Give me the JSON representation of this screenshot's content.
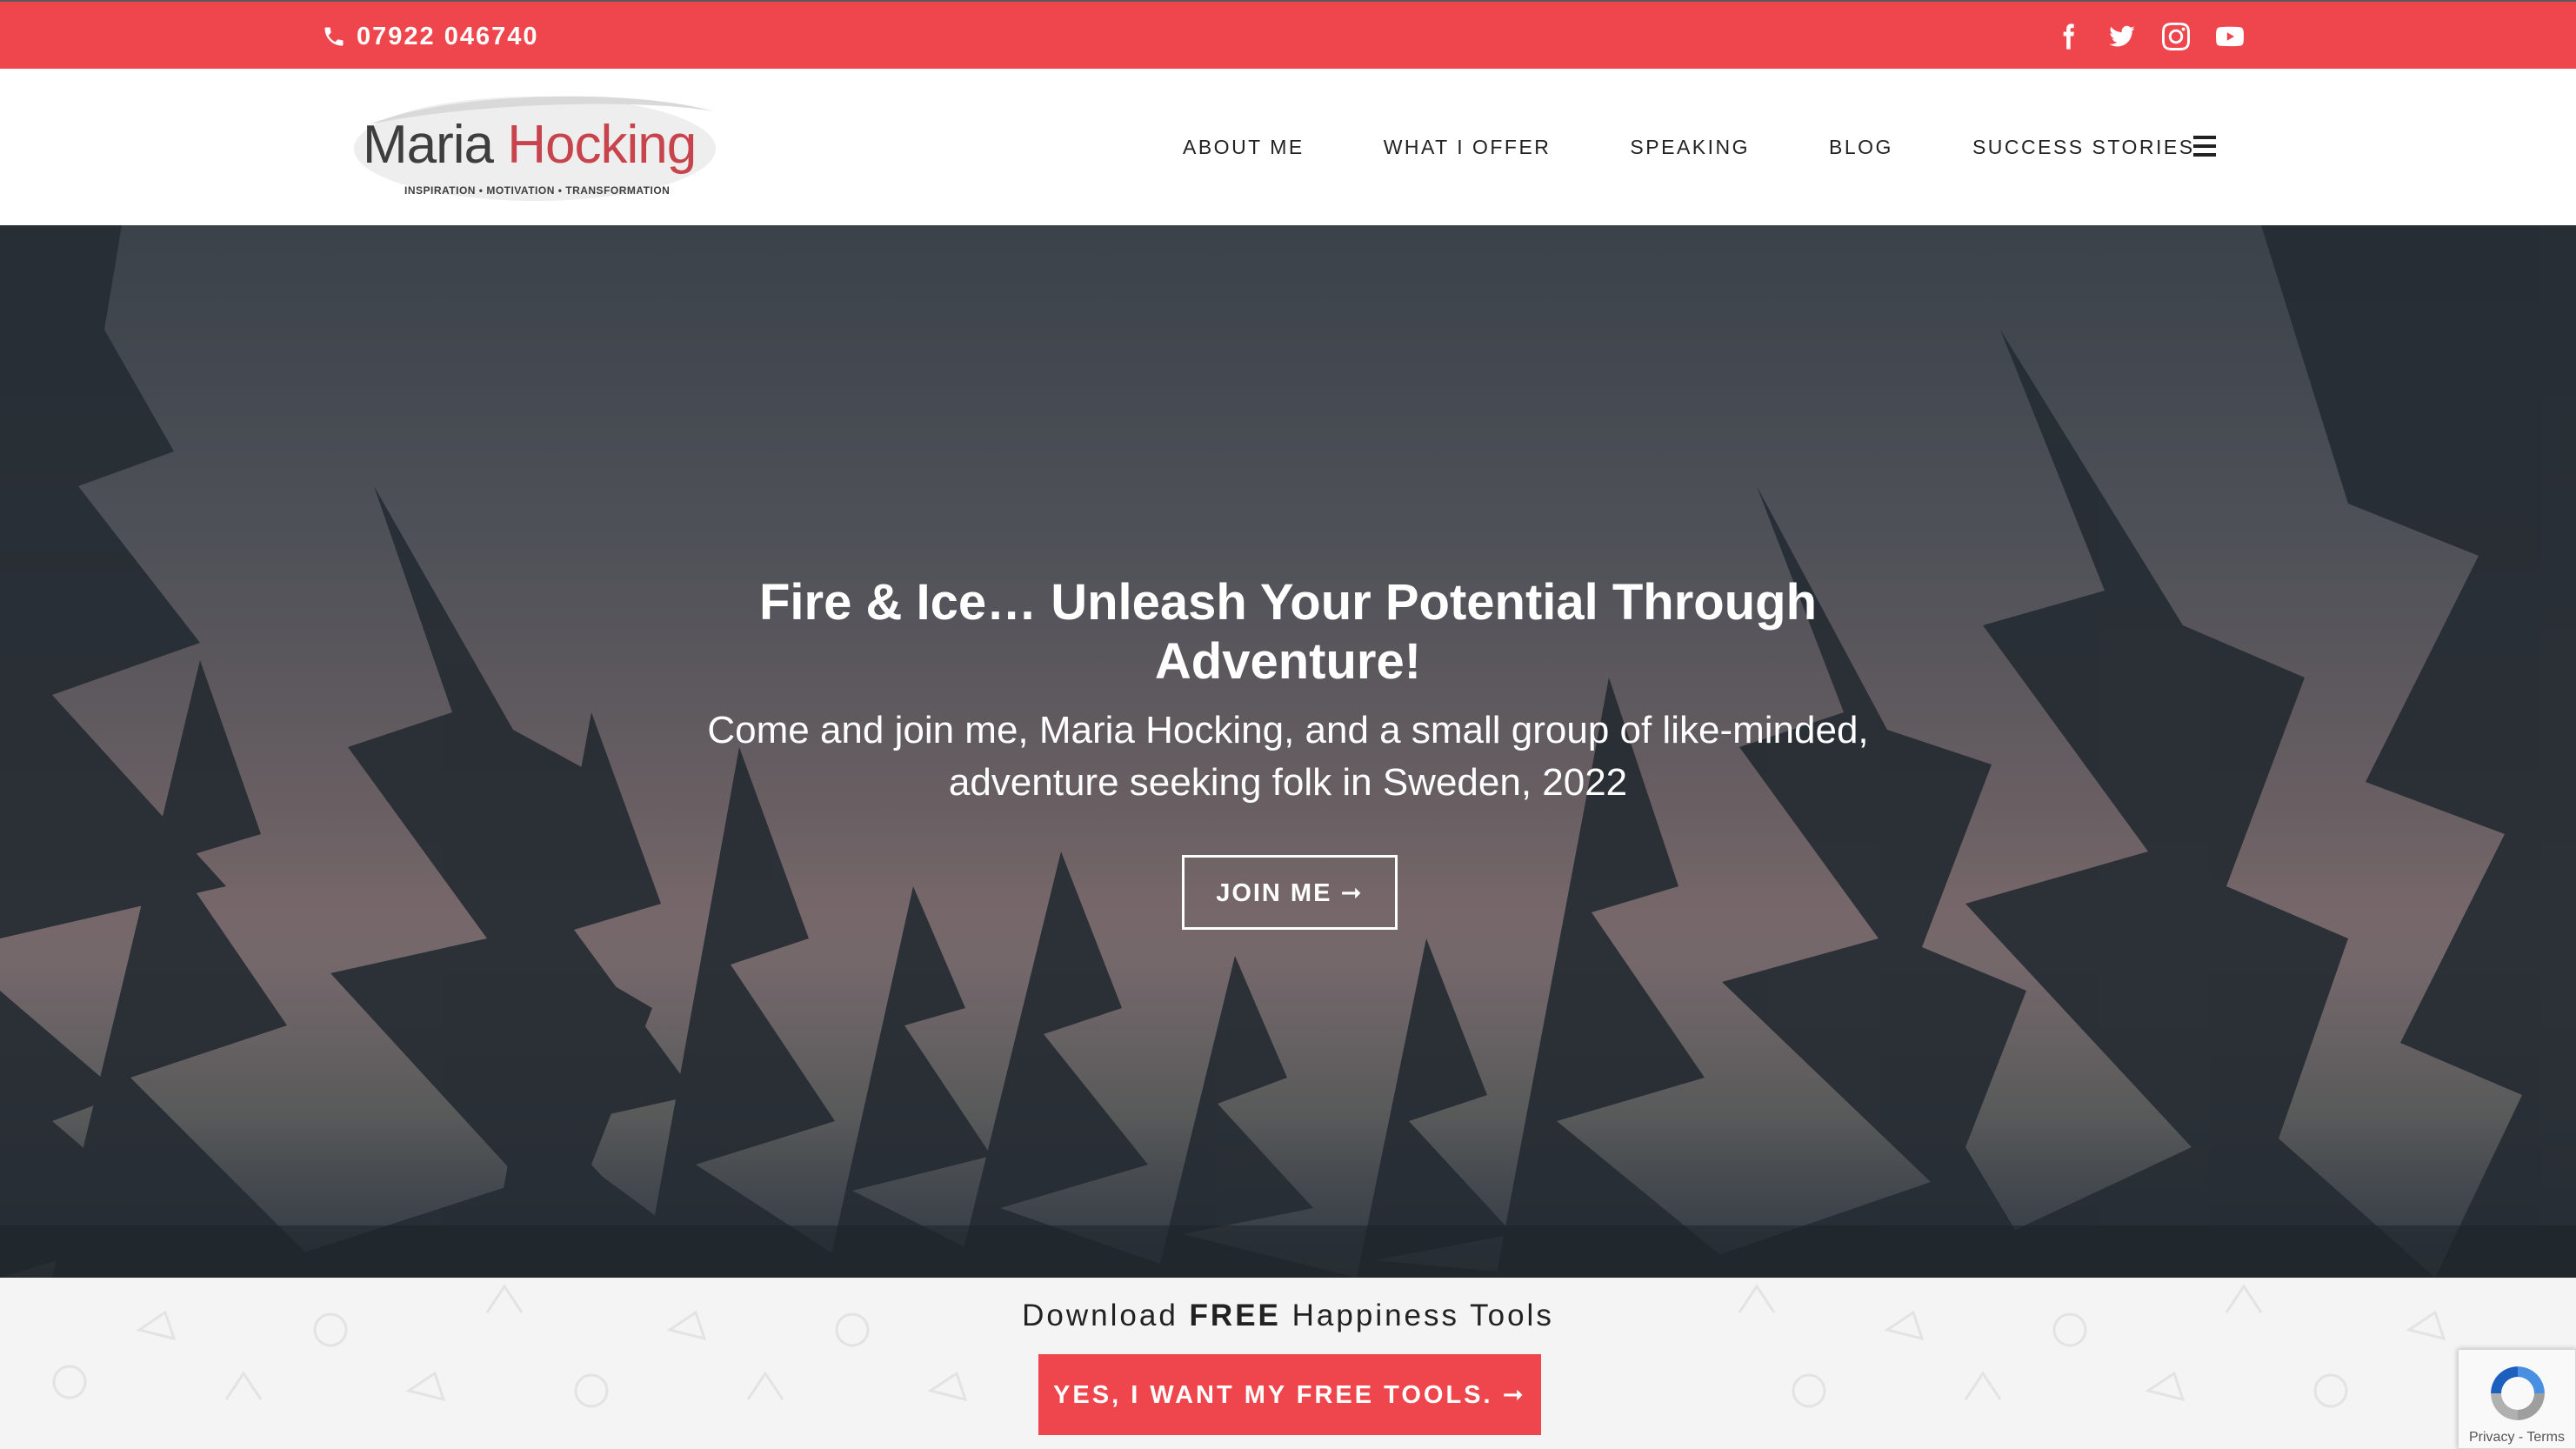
{
  "topbar": {
    "phone": "07922 046740",
    "socials": [
      "facebook-icon",
      "twitter-icon",
      "instagram-icon",
      "youtube-icon"
    ],
    "background": "#ef464e"
  },
  "header": {
    "logo": {
      "first_name": "Maria",
      "last_name": "Hocking",
      "tagline": "INSPIRATION • MOTIVATION • TRANSFORMATION"
    },
    "nav": [
      {
        "label": "ABOUT ME"
      },
      {
        "label": "WHAT I OFFER"
      },
      {
        "label": "SPEAKING"
      },
      {
        "label": "BLOG"
      },
      {
        "label": "SUCCESS STORIES"
      }
    ],
    "menu_icon": "hamburger-icon"
  },
  "hero": {
    "title": "Fire & Ice… Unleash Your Potential Through Adventure!",
    "subtitle": "Come and join me, Maria Hocking, and a small group of like-minded, adventure seeking folk in Sweden, 2022",
    "button_label": "JOIN ME ➞"
  },
  "banner": {
    "text_prefix": "Download",
    "text_bold": "FREE",
    "text_suffix": "Happiness Tools",
    "button_label": "YES, I WANT MY FREE TOOLS. ➞",
    "accent": "#ef464e"
  },
  "recaptcha": {
    "links": "Privacy - Terms"
  }
}
